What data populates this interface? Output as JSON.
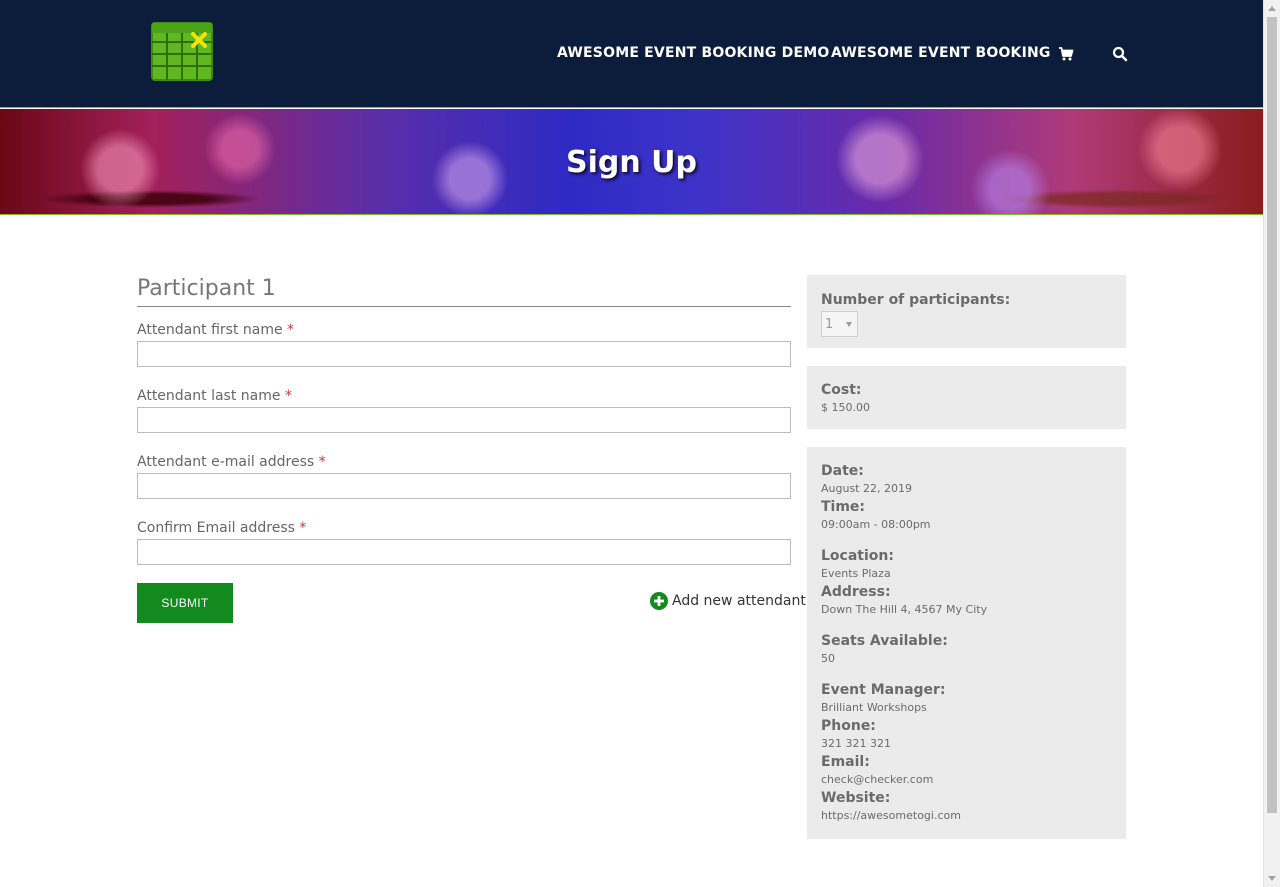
{
  "nav": {
    "links": [
      "AWESOME EVENT BOOKING DEMO",
      "AWESOME EVENT BOOKING"
    ],
    "cart_icon": "shopping-cart-icon",
    "search_icon": "search-icon"
  },
  "hero": {
    "title": "Sign Up"
  },
  "form": {
    "participant_title": "Participant 1",
    "fields": [
      {
        "label": "Attendant first name",
        "required": "*",
        "value": ""
      },
      {
        "label": "Attendant last name",
        "required": "*",
        "value": ""
      },
      {
        "label": "Attendant e-mail address",
        "required": "*",
        "value": ""
      },
      {
        "label": "Confirm Email address",
        "required": "*",
        "value": ""
      }
    ],
    "submit_label": "SUBMIT",
    "add_attendant_label": "Add new attendant",
    "add_icon": "plus-circle-icon"
  },
  "sidebar": {
    "participants": {
      "label": "Number of participants:",
      "selected": "1"
    },
    "cost": {
      "label": "Cost:",
      "value": "$ 150.00"
    },
    "details": {
      "date_label": "Date:",
      "date": "August 22, 2019",
      "time_label": "Time:",
      "time": "09:00am - 08:00pm",
      "location_label": "Location:",
      "location": "Events Plaza",
      "address_label": "Address:",
      "address": "Down The Hill 4, 4567 My City",
      "seats_label": "Seats Available:",
      "seats": "50",
      "manager_label": "Event Manager:",
      "manager": "Brilliant Workshops",
      "phone_label": "Phone:",
      "phone": "321 321 321",
      "email_label": "Email:",
      "email": "check@checker.com",
      "website_label": "Website:",
      "website": "https://awesometogi.com"
    }
  },
  "colors": {
    "header_bg": "#0b1d3a",
    "accent_green": "#138a1e",
    "logo_green": "#5fb820",
    "panel_bg": "#ebebeb",
    "required_red": "#e03030"
  }
}
